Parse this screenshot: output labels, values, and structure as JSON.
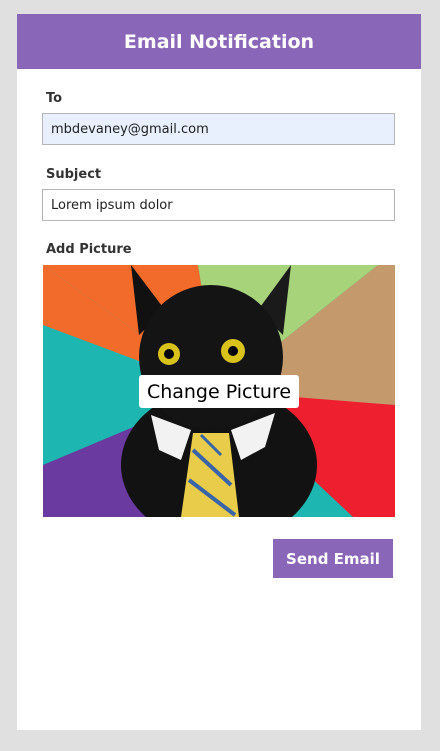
{
  "header": {
    "title": "Email Notification"
  },
  "form": {
    "to": {
      "label": "To",
      "value": "mbdevaney@gmail.com"
    },
    "subject": {
      "label": "Subject",
      "value": "Lorem ipsum dolor"
    },
    "picture": {
      "label": "Add Picture",
      "change_label": "Change Picture"
    }
  },
  "actions": {
    "send_label": "Send Email"
  },
  "colors": {
    "accent": "#8a66b9",
    "background": "#e0e0e0",
    "autofill": "#e8f0fe"
  },
  "icons": {
    "picture": "cat-picture-image"
  }
}
